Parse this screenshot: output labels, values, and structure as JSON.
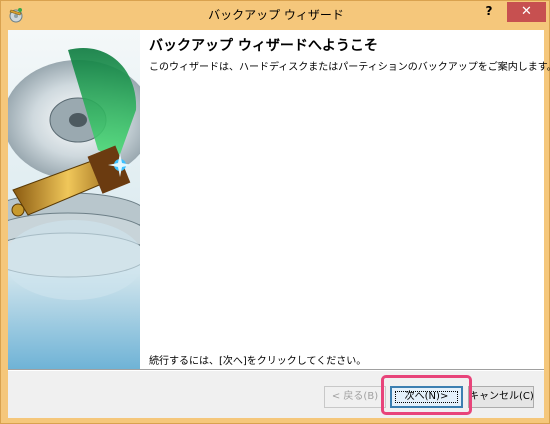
{
  "window": {
    "title": "バックアップ ウィザード",
    "help_label": "?",
    "close_label": "✕"
  },
  "main": {
    "heading": "バックアップ ウィザードへようこそ",
    "description": "このウィザードは、ハードディスクまたはパーティションのバックアップをご案内します。",
    "instruction": "続行するには、[次へ]をクリックしてください。"
  },
  "buttons": {
    "back_label": "< 戻る(B)",
    "next_label": "次へ(N)>",
    "cancel_label": "キャンセル(C)"
  },
  "colors": {
    "accent_highlight": "#e8447a",
    "titlebar": "#f5c77b",
    "close_button": "#c75050"
  }
}
